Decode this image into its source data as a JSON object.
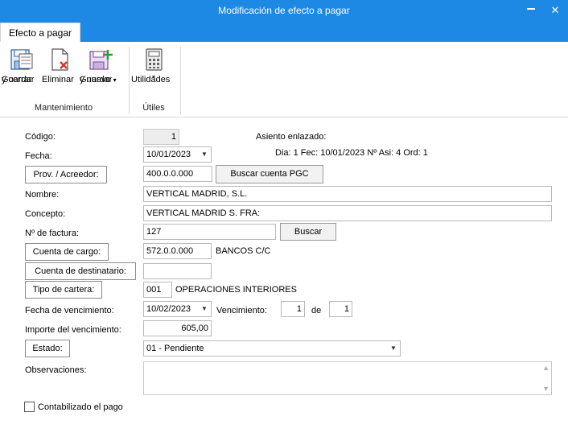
{
  "window": {
    "title": "Modificación de efecto a pagar"
  },
  "ribbon": {
    "tab": "Efecto a pagar",
    "buttons": {
      "save_close": {
        "line1": "Guardar",
        "line2": "y cerrar"
      },
      "delete": {
        "line1": "Eliminar"
      },
      "save_new": {
        "line1": "Guardar",
        "line2": "y nuevo"
      },
      "utilities": {
        "line1": "Utilidades"
      }
    },
    "groups": {
      "maintenance": "Mantenimiento",
      "utilities": "Útiles"
    }
  },
  "form": {
    "codigo": {
      "label": "Código:",
      "value": "1"
    },
    "asiento": {
      "label": "Asiento enlazado:",
      "detail": "Dia: 1 Fec: 10/01/2023 Nº Asi: 4 Ord: 1"
    },
    "fecha": {
      "label": "Fecha:",
      "value": "10/01/2023"
    },
    "proveedor": {
      "label": "Prov. / Acreedor:",
      "value": "400.0.0.000",
      "button": "Buscar cuenta PGC"
    },
    "nombre": {
      "label": "Nombre:",
      "value": "VERTICAL MADRID, S.L."
    },
    "concepto": {
      "label": "Concepto:",
      "value": "VERTICAL MADRID S. FRA:"
    },
    "factura": {
      "label": "Nº de factura:",
      "value": "127",
      "button": "Buscar"
    },
    "cuenta_cargo": {
      "label": "Cuenta de cargo:",
      "value": "572.0.0.000",
      "name": "BANCOS C/C"
    },
    "cuenta_destinatario": {
      "label": "Cuenta de destinatario:",
      "value": ""
    },
    "tipo_cartera": {
      "label": "Tipo de cartera:",
      "value": "001",
      "name": "OPERACIONES INTERIORES"
    },
    "vencimiento": {
      "label": "Fecha de vencimiento:",
      "value": "10/02/2023",
      "venc_label": "Vencimiento:",
      "venc_num": "1",
      "de_label": "de",
      "venc_total": "1"
    },
    "importe": {
      "label": "Importe del vencimiento:",
      "value": "605,00"
    },
    "estado": {
      "label": "Estado:",
      "value": "01 - Pendiente"
    },
    "observaciones": {
      "label": "Observaciones:",
      "value": ""
    },
    "contabilizado": {
      "label": "Contabilizado el pago",
      "checked": false
    }
  }
}
